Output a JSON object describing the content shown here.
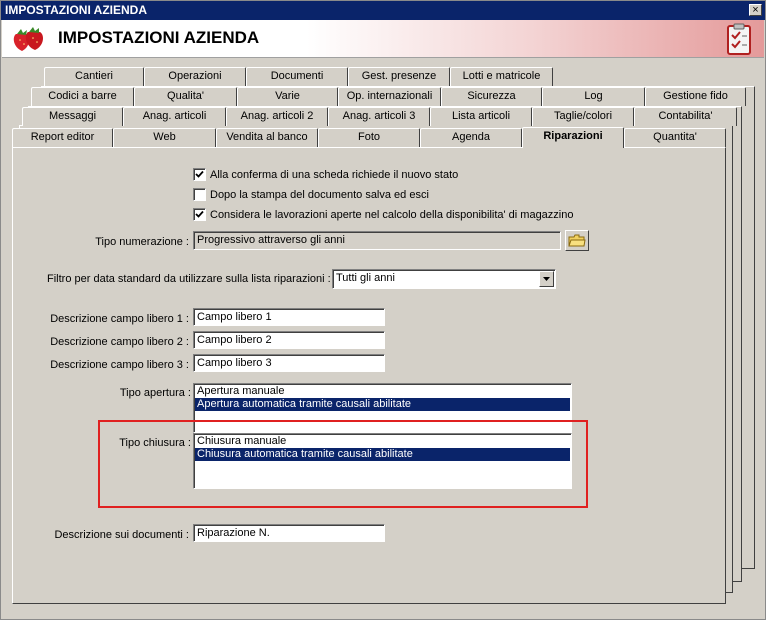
{
  "window": {
    "title": "IMPOSTAZIONI AZIENDA",
    "close_glyph": "×"
  },
  "header": {
    "title": "IMPOSTAZIONI AZIENDA",
    "logo_icon": "strawberries-icon",
    "doc_icon": "clipboard-check-icon"
  },
  "tabs": {
    "row1": [
      "Cantieri",
      "Operazioni",
      "Documenti",
      "Gest. presenze",
      "Lotti e matricole"
    ],
    "row2": [
      "Codici a barre",
      "Qualita'",
      "Varie",
      "Op. internazionali",
      "Sicurezza",
      "Log",
      "Gestione fido"
    ],
    "row3": [
      "Messaggi",
      "Anag. articoli",
      "Anag. articoli 2",
      "Anag. articoli 3",
      "Lista articoli",
      "Taglie/colori",
      "Contabilita'"
    ],
    "row4": [
      "Report editor",
      "Web",
      "Vendita al banco",
      "Foto",
      "Agenda",
      "Riparazioni",
      "Quantita'"
    ],
    "active": "Riparazioni"
  },
  "form": {
    "checkboxes": [
      {
        "label": "Alla conferma di una scheda richiede il nuovo stato",
        "checked": true
      },
      {
        "label": "Dopo la stampa del documento salva ed esci",
        "checked": false
      },
      {
        "label": "Considera le lavorazioni aperte nel calcolo della disponibilita' di magazzino",
        "checked": true
      }
    ],
    "tipo_numerazione": {
      "label": "Tipo numerazione :",
      "value": "Progressivo attraverso gli anni"
    },
    "filtro": {
      "label": "Filtro per data standard da utilizzare sulla lista riparazioni :",
      "value": "Tutti gli anni"
    },
    "campi_liberi": [
      {
        "label": "Descrizione campo libero 1 :",
        "value": "Campo libero 1"
      },
      {
        "label": "Descrizione campo libero 2 :",
        "value": "Campo libero 2"
      },
      {
        "label": "Descrizione campo libero 3 :",
        "value": "Campo libero 3"
      }
    ],
    "tipo_apertura": {
      "label": "Tipo apertura :",
      "options": [
        "Apertura manuale",
        "Apertura automatica tramite causali abilitate"
      ],
      "selected": "Apertura automatica tramite causali abilitate"
    },
    "tipo_chiusura": {
      "label": "Tipo chiusura :",
      "options": [
        "Chiusura manuale",
        "Chiusura automatica tramite causali abilitate"
      ],
      "selected": "Chiusura automatica tramite causali abilitate"
    },
    "descrizione_documenti": {
      "label": "Descrizione sui documenti :",
      "value": "Riparazione N."
    }
  },
  "colors": {
    "title_bar": "#0a246a",
    "selection": "#0a246a",
    "highlight_box": "#e02020"
  }
}
